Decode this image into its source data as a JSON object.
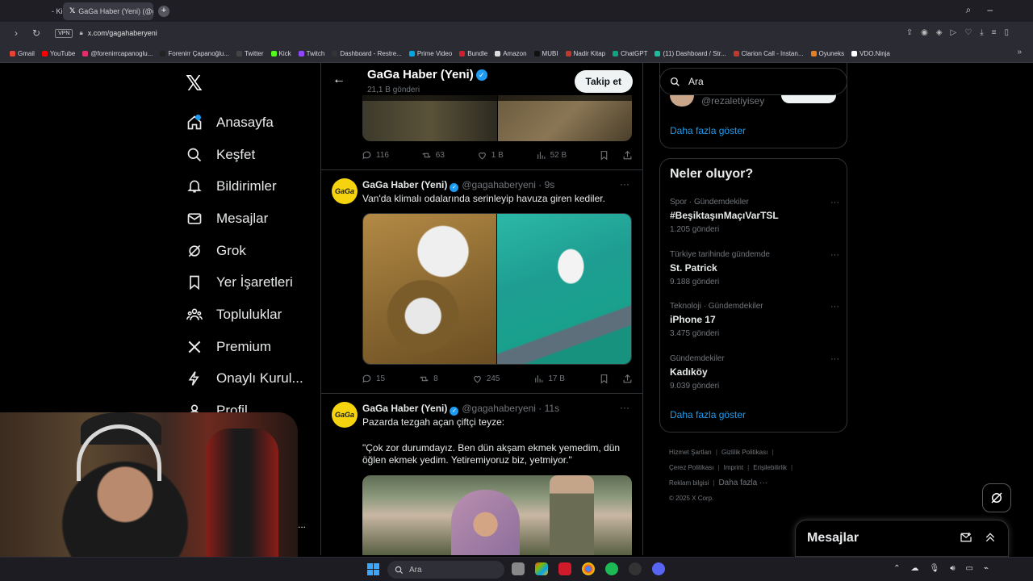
{
  "browser": {
    "tabs": [
      {
        "label": "- Kick Dashboard",
        "active": false
      },
      {
        "label": "GaGa Haber (Yeni) (@gag",
        "active": true
      }
    ],
    "new_tab": "+",
    "vpn": "VPN",
    "url": "x.com/gagahaberyeni",
    "bookmarks": [
      {
        "label": "Gmail",
        "color": "#ea4335"
      },
      {
        "label": "YouTube",
        "color": "#ff0000"
      },
      {
        "label": "@forenirrcapanoglu...",
        "color": "#e1306c"
      },
      {
        "label": "Forenirr Çapanoğlu...",
        "color": "#222222"
      },
      {
        "label": "Twitter",
        "color": "#444444"
      },
      {
        "label": "Kick",
        "color": "#53fc18"
      },
      {
        "label": "Twitch",
        "color": "#9146ff"
      },
      {
        "label": "Dashboard - Restre...",
        "color": "#333333"
      },
      {
        "label": "Prime Video",
        "color": "#00a8e1"
      },
      {
        "label": "Bundle",
        "color": "#d01f2e"
      },
      {
        "label": "Amazon",
        "color": "#dddddd"
      },
      {
        "label": "MUBI",
        "color": "#111111"
      },
      {
        "label": "Nadir Kitap",
        "color": "#c0392b"
      },
      {
        "label": "ChatGPT",
        "color": "#10a37f"
      },
      {
        "label": "(11) Dashboard / Str...",
        "color": "#1abc9c"
      },
      {
        "label": "Clarion Call - Instan...",
        "color": "#c0392b"
      },
      {
        "label": "Oyuneks",
        "color": "#e67e22"
      },
      {
        "label": "VDO.Ninja",
        "color": "#ffffff"
      }
    ]
  },
  "nav": {
    "items": [
      {
        "label": "Anasayfa",
        "icon": "home-icon"
      },
      {
        "label": "Keşfet",
        "icon": "search-icon"
      },
      {
        "label": "Bildirimler",
        "icon": "bell-icon"
      },
      {
        "label": "Mesajlar",
        "icon": "mail-icon"
      },
      {
        "label": "Grok",
        "icon": "grok-icon"
      },
      {
        "label": "Yer İşaretleri",
        "icon": "bookmark-icon"
      },
      {
        "label": "Topluluklar",
        "icon": "communities-icon"
      },
      {
        "label": "Premium",
        "icon": "x-icon"
      },
      {
        "label": "Onaylı Kurul...",
        "icon": "lightning-icon"
      },
      {
        "label": "Profil",
        "icon": "person-icon"
      }
    ],
    "more": "..."
  },
  "profile_header": {
    "name": "GaGa Haber (Yeni)",
    "post_count": "21,1 B gönderi",
    "follow_label": "Takip et"
  },
  "prev_tweet_actions": {
    "replies": "116",
    "reposts": "63",
    "likes": "1 B",
    "views": "52 B"
  },
  "tweets": [
    {
      "name": "GaGa Haber (Yeni)",
      "handle": "@gagahaberyeni · 9s",
      "text": "Van'da klimalı odalarında serinleyip havuza giren kediler.",
      "avatar_text": "GaGa",
      "actions": {
        "replies": "15",
        "reposts": "8",
        "likes": "245",
        "views": "17 B"
      }
    },
    {
      "name": "GaGa Haber (Yeni)",
      "handle": "@gagahaberyeni · 11s",
      "text": "Pazarda tezgah açan çiftçi teyze:",
      "quote": "\"Çok zor durumdayız. Ben dün akşam ekmek yemedim, dün öğlen ekmek yedim. Yetiremiyoruz biz, yetmiyor.\"",
      "avatar_text": "GaGa"
    }
  ],
  "right": {
    "search_placeholder": "Ara",
    "rez_handle": "@rezaletiyisey",
    "show_more": "Daha fazla göster",
    "trends_title": "Neler oluyor?",
    "trends": [
      {
        "category": "Spor · Gündemdekiler",
        "topic": "#BeşiktaşınMaçıVarTSL",
        "count": "1.205 gönderi"
      },
      {
        "category": "Türkiye tarihinde gündemde",
        "topic": "St. Patrick",
        "count": "9.188 gönderi"
      },
      {
        "category": "Teknoloji · Gündemdekiler",
        "topic": "iPhone 17",
        "count": "3.475 gönderi"
      },
      {
        "category": "Gündemdekiler",
        "topic": "Kadıköy",
        "count": "9.039 gönderi"
      }
    ],
    "show_more_2": "Daha fazla göster",
    "footer": {
      "l1": "Hizmet Şartları",
      "l2": "Gizlilik Politikası",
      "l3": "Çerez Politikası",
      "l4": "Imprint",
      "l5": "Erişilebilirlik",
      "l6": "Reklam bilgisi",
      "l7": "Daha fazla ···",
      "copyright": "© 2025 X Corp."
    }
  },
  "messages_drawer": {
    "title": "Mesajlar"
  },
  "taskbar": {
    "search": "Ara"
  },
  "colors": {
    "accent": "#1d9bf0",
    "background": "#000000",
    "border": "#2f3336",
    "muted": "#71767b"
  }
}
